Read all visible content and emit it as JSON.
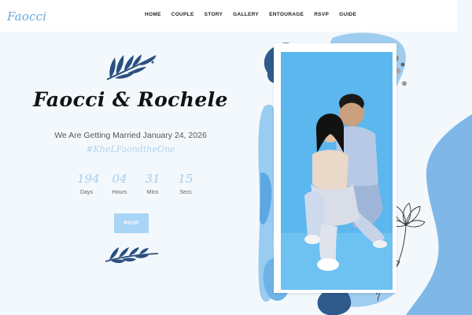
{
  "header": {
    "logo": "Faocci",
    "nav": [
      "HOME",
      "COUPLE",
      "STORY",
      "GALLERY",
      "ENTOURAGE",
      "RSVP",
      "GUIDE"
    ]
  },
  "hero": {
    "names": "Faocci & Rochele",
    "subtitle": "We Are Getting Married January 24, 2026",
    "hashtag": "#KheLFaondtheOne",
    "countdown": [
      {
        "value": "194",
        "label": "Days"
      },
      {
        "value": "04",
        "label": "Hours"
      },
      {
        "value": "31",
        "label": "Mins"
      },
      {
        "value": "15",
        "label": "Secs"
      }
    ],
    "rsvp_label": "RSVP"
  },
  "colors": {
    "accent": "#a8d4f6",
    "accent_text": "#a9cdee",
    "brand": "#6ba7da",
    "page_bg": "#f3f8fc",
    "photo_bg": "#5bb7ee",
    "navy": "#2b4f80"
  },
  "icons": {
    "leaf_top": "leaf-branch-icon",
    "leaf_bottom": "leaf-branch-icon",
    "flower": "lotus-flower-icon"
  }
}
